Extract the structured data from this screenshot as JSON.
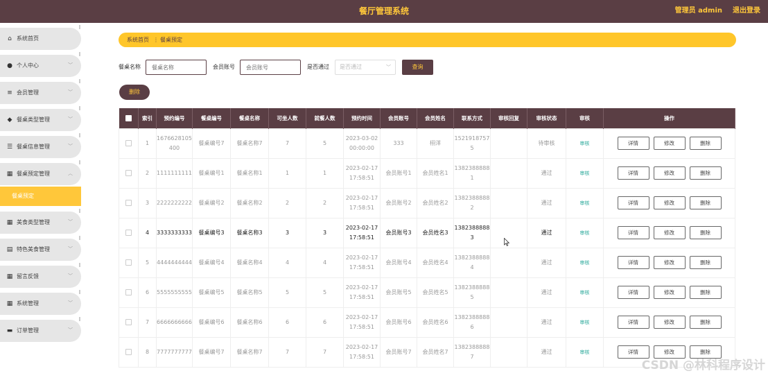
{
  "header": {
    "title": "餐厅管理系统",
    "admin": "管理员 admin",
    "logout": "退出登录"
  },
  "sidebar": {
    "items": [
      {
        "label": "系统首页",
        "icon": "home-icon",
        "glyph": "⌂",
        "chevron": ""
      },
      {
        "label": "个人中心",
        "icon": "user-icon",
        "glyph": "●",
        "chevron": "﹀"
      },
      {
        "label": "会员管理",
        "icon": "list-icon",
        "glyph": "≡",
        "chevron": "﹀"
      },
      {
        "label": "餐桌类型管理",
        "icon": "pin-icon",
        "glyph": "◆",
        "chevron": "﹀"
      },
      {
        "label": "餐桌信息管理",
        "icon": "sliders-icon",
        "glyph": "☰",
        "chevron": "﹀"
      },
      {
        "label": "餐桌预定管理",
        "icon": "grid-icon",
        "glyph": "▦",
        "chevron": "︿"
      },
      {
        "label": "美食类型管理",
        "icon": "grid-icon",
        "glyph": "▦",
        "chevron": "﹀"
      },
      {
        "label": "特色美食管理",
        "icon": "table-icon",
        "glyph": "▤",
        "chevron": "﹀"
      },
      {
        "label": "留言反馈",
        "icon": "grid-icon",
        "glyph": "▦",
        "chevron": "﹀"
      },
      {
        "label": "系统管理",
        "icon": "grid-icon",
        "glyph": "▦",
        "chevron": "﹀"
      },
      {
        "label": "订单管理",
        "icon": "card-icon",
        "glyph": "▬",
        "chevron": "﹀"
      }
    ],
    "active_sub": "餐桌预定"
  },
  "breadcrumb": {
    "home": "系统首页",
    "sep": "⋮",
    "current": "餐桌预定"
  },
  "filters": {
    "table_name_label": "餐桌名称",
    "table_name_placeholder": "餐桌名称",
    "account_label": "会员账号",
    "account_placeholder": "会员账号",
    "approved_label": "是否通过",
    "approved_placeholder": "是否通过",
    "query_button": "查询"
  },
  "batch_delete": "删除",
  "table": {
    "headers": [
      "索引",
      "预约编号",
      "餐桌编号",
      "餐桌名称",
      "可坐人数",
      "就餐人数",
      "预约时间",
      "会员账号",
      "会员姓名",
      "联系方式",
      "审核回复",
      "审核状态",
      "审核",
      "操作"
    ],
    "actions": {
      "detail": "详情",
      "edit": "修改",
      "delete": "删除"
    },
    "rows": [
      {
        "idx": "1",
        "no": "1676628105400",
        "tno": "餐桌编号7",
        "tname": "餐桌名称7",
        "seats": "7",
        "diners": "5",
        "time": "2023-03-02 00:00:00",
        "acct": "333",
        "name": "栩洋",
        "phone": "15219187575",
        "reply": "",
        "status": "待审核",
        "review": "审核"
      },
      {
        "idx": "2",
        "no": "1111111111",
        "tno": "餐桌编号1",
        "tname": "餐桌名称1",
        "seats": "1",
        "diners": "1",
        "time": "2023-02-17 17:58:51",
        "acct": "会员账号1",
        "name": "会员姓名1",
        "phone": "13823888881",
        "reply": "",
        "status": "通过",
        "review": "审核"
      },
      {
        "idx": "3",
        "no": "2222222222",
        "tno": "餐桌编号2",
        "tname": "餐桌名称2",
        "seats": "2",
        "diners": "2",
        "time": "2023-02-17 17:58:51",
        "acct": "会员账号2",
        "name": "会员姓名2",
        "phone": "13823888882",
        "reply": "",
        "status": "通过",
        "review": "审核"
      },
      {
        "idx": "4",
        "no": "3333333333",
        "tno": "餐桌编号3",
        "tname": "餐桌名称3",
        "seats": "3",
        "diners": "3",
        "time": "2023-02-17 17:58:51",
        "acct": "会员账号3",
        "name": "会员姓名3",
        "phone": "13823888883",
        "reply": "",
        "status": "通过",
        "review": "审核"
      },
      {
        "idx": "5",
        "no": "4444444444",
        "tno": "餐桌编号4",
        "tname": "餐桌名称4",
        "seats": "4",
        "diners": "4",
        "time": "2023-02-17 17:58:51",
        "acct": "会员账号4",
        "name": "会员姓名4",
        "phone": "13823888884",
        "reply": "",
        "status": "通过",
        "review": "审核"
      },
      {
        "idx": "6",
        "no": "5555555555",
        "tno": "餐桌编号5",
        "tname": "餐桌名称5",
        "seats": "5",
        "diners": "5",
        "time": "2023-02-17 17:58:51",
        "acct": "会员账号5",
        "name": "会员姓名5",
        "phone": "13823888885",
        "reply": "",
        "status": "通过",
        "review": "审核"
      },
      {
        "idx": "7",
        "no": "6666666666",
        "tno": "餐桌编号6",
        "tname": "餐桌名称6",
        "seats": "6",
        "diners": "6",
        "time": "2023-02-17 17:58:51",
        "acct": "会员账号6",
        "name": "会员姓名6",
        "phone": "13823888886",
        "reply": "",
        "status": "通过",
        "review": "审核"
      },
      {
        "idx": "8",
        "no": "7777777777",
        "tno": "餐桌编号7",
        "tname": "餐桌名称7",
        "seats": "7",
        "diners": "7",
        "time": "2023-02-17 17:58:51",
        "acct": "会员账号7",
        "name": "会员姓名7",
        "phone": "13823888887",
        "reply": "",
        "status": "通过",
        "review": "审核"
      }
    ]
  },
  "watermark": "CSDN @林科程序设计",
  "colors": {
    "header_bg": "#5a3e44",
    "accent": "#ffc73a",
    "review_link": "#2aa89a"
  }
}
